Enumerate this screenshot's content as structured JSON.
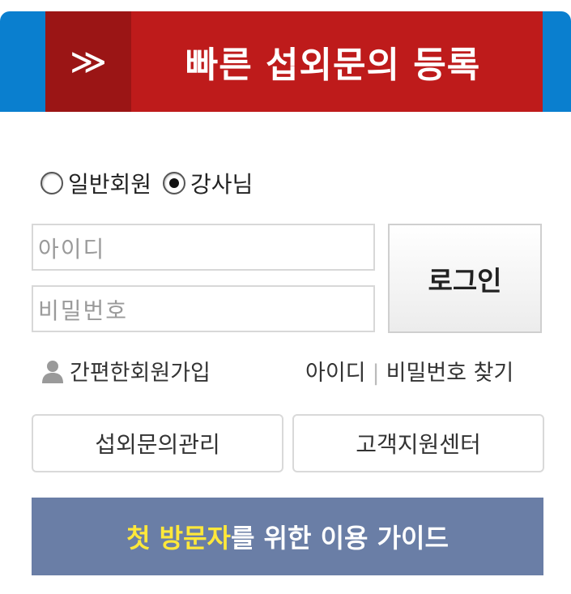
{
  "banner": {
    "arrow": "≫",
    "title": "빠른 섭외문의 등록"
  },
  "member_type": {
    "options": [
      {
        "label": "일반회원",
        "selected": false
      },
      {
        "label": "강사님",
        "selected": true
      }
    ]
  },
  "login": {
    "id_placeholder": "아이디",
    "password_placeholder": "비밀번호",
    "button_label": "로그인"
  },
  "links": {
    "signup_label": "간편한회원가입",
    "find_id_label": "아이디",
    "separator": "|",
    "find_password_label": "비밀번호 찾기"
  },
  "buttons": {
    "inquiry_manage": "섭외문의관리",
    "customer_center": "고객지원센터"
  },
  "guide": {
    "highlight": "첫 방문자",
    "rest": "를 위한 이용 가이드"
  },
  "colors": {
    "banner_red": "#be1b1b",
    "banner_dark_red": "#9b1515",
    "side_blue": "#0a7fcf",
    "guide_blue": "#6a7ea6",
    "guide_highlight": "#ffe83a"
  }
}
